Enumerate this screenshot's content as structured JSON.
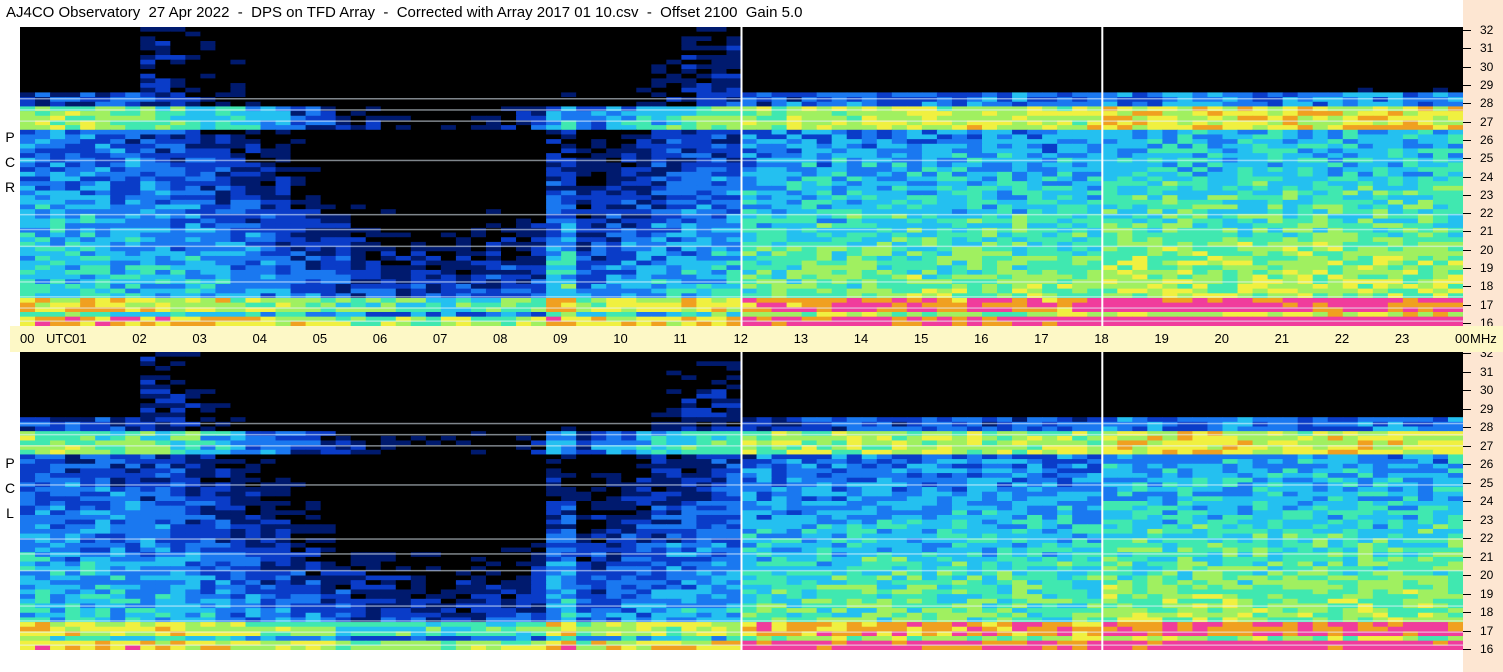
{
  "header": {
    "title": "AJ4CO Observatory  27 Apr 2022  -  DPS on TFD Array  -  Corrected with Array 2017 01 10.csv  -  Offset 2100  Gain 5.0"
  },
  "panels": {
    "top_polarization": [
      "R",
      "C",
      "P"
    ],
    "bottom_polarization": [
      "L",
      "C",
      "P"
    ]
  },
  "chart_data": {
    "type": "heatmap",
    "title": "AJ4CO Observatory  27 Apr 2022  -  DPS on TFD Array  -  Corrected with Array 2017 01 10.csv  -  Offset 2100  Gain 5.0",
    "x_axis": {
      "unit": "UTC",
      "range": [
        0,
        24
      ],
      "tick_labels": [
        "00",
        "01",
        "02",
        "03",
        "04",
        "05",
        "06",
        "07",
        "08",
        "09",
        "10",
        "11",
        "12",
        "13",
        "14",
        "15",
        "16",
        "17",
        "18",
        "19",
        "20",
        "21",
        "22",
        "23",
        "00"
      ]
    },
    "y_axis": {
      "unit": "MHz",
      "range": [
        16,
        32
      ],
      "tick_labels": [
        "16",
        "17",
        "18",
        "19",
        "20",
        "21",
        "22",
        "23",
        "24",
        "25",
        "26",
        "27",
        "28",
        "29",
        "30",
        "31",
        "32"
      ]
    },
    "colormap": [
      "#000000",
      "#001a6e",
      "#0a3cc8",
      "#1a78f0",
      "#24c0f0",
      "#40e8b0",
      "#a0f060",
      "#f0f040",
      "#f0a020",
      "#f03c9c",
      "#ffffff"
    ],
    "vertical_markers_utc": [
      12,
      18
    ],
    "series": [
      {
        "name": "R C P"
      },
      {
        "name": "L C P"
      }
    ]
  }
}
